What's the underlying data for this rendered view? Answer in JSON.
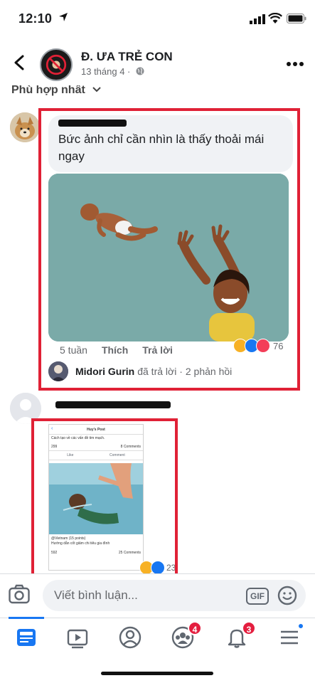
{
  "status_bar": {
    "time": "12:10"
  },
  "header": {
    "page_name": "Đ. ƯA TRẺ CON",
    "date": "13 tháng 4 ·"
  },
  "sort": {
    "label": "Phù hợp nhất"
  },
  "comment1": {
    "text": "Bức ảnh chỉ cần nhìn là thấy thoải mái ngay",
    "time": "5 tuần",
    "like_label": "Thích",
    "reply_label": "Trả lời",
    "reaction_count": "76",
    "reply_preview": {
      "name": "Midori Gurin",
      "action": "đã trả lời ·",
      "count": "2 phản hồi"
    }
  },
  "comment2": {
    "thumbnail": {
      "post_title": "Huy's Post",
      "line1": "Cách tạo về các vấn đề tim mạch.",
      "line2": "@Vietnam (15 points)",
      "line3": "Hướng dẫn cốt giảm chi tiêu gia đình",
      "comments_1": "8 Comments",
      "comments_2": "25 Comments",
      "like": "Like",
      "comment": "Comment",
      "count_a": "299",
      "count_b": "592"
    },
    "reaction_count": "23"
  },
  "composer": {
    "placeholder": "Viết bình luận...",
    "gif_label": "GIF"
  },
  "tabbar": {
    "groups_badge": "4",
    "notifications_badge": "3"
  },
  "colors": {
    "accent": "#1877f2",
    "highlight_box": "#e02136",
    "badge": "#e41e3f"
  }
}
